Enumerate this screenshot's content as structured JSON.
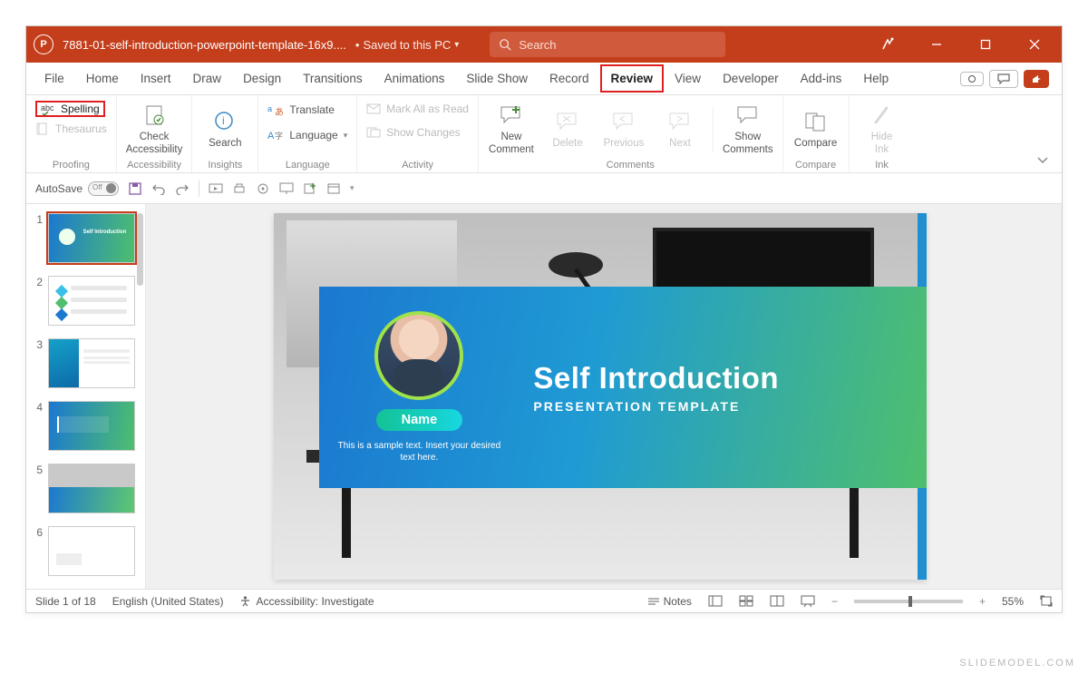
{
  "title_bar": {
    "app_icon_text": "P",
    "doc_name": "7881-01-self-introduction-powerpoint-template-16x9....",
    "saved_status": "Saved to this PC",
    "search_placeholder": "Search"
  },
  "tabs": {
    "items": [
      "File",
      "Home",
      "Insert",
      "Draw",
      "Design",
      "Transitions",
      "Animations",
      "Slide Show",
      "Record",
      "Review",
      "View",
      "Developer",
      "Add-ins",
      "Help"
    ],
    "active": "Review",
    "highlighted": "Review"
  },
  "ribbon": {
    "proofing": {
      "spelling": "Spelling",
      "thesaurus": "Thesaurus",
      "group_label": "Proofing"
    },
    "accessibility": {
      "btn": "Check\nAccessibility",
      "group_label": "Accessibility"
    },
    "insights": {
      "btn": "Search",
      "group_label": "Insights"
    },
    "language": {
      "translate": "Translate",
      "language": "Language",
      "group_label": "Language"
    },
    "activity": {
      "mark": "Mark All as Read",
      "show": "Show Changes",
      "group_label": "Activity"
    },
    "comments": {
      "new": "New\nComment",
      "delete": "Delete",
      "previous": "Previous",
      "next": "Next",
      "show": "Show\nComments",
      "group_label": "Comments"
    },
    "compare": {
      "btn": "Compare",
      "group_label": "Compare"
    },
    "ink": {
      "btn": "Hide\nInk",
      "group_label": "Ink"
    }
  },
  "qat": {
    "autosave_label": "AutoSave",
    "autosave_state": "Off"
  },
  "thumbnails": {
    "count_visible": 6,
    "selected": 1
  },
  "slide": {
    "title": "Self Introduction",
    "subtitle": "PRESENTATION TEMPLATE",
    "name_label": "Name",
    "sample_text": "This is a sample text. Insert your desired text here."
  },
  "status": {
    "slide_pos": "Slide 1 of 18",
    "language": "English (United States)",
    "accessibility": "Accessibility: Investigate",
    "notes": "Notes",
    "zoom": "55%"
  },
  "watermark": "SLIDEMODEL.COM"
}
